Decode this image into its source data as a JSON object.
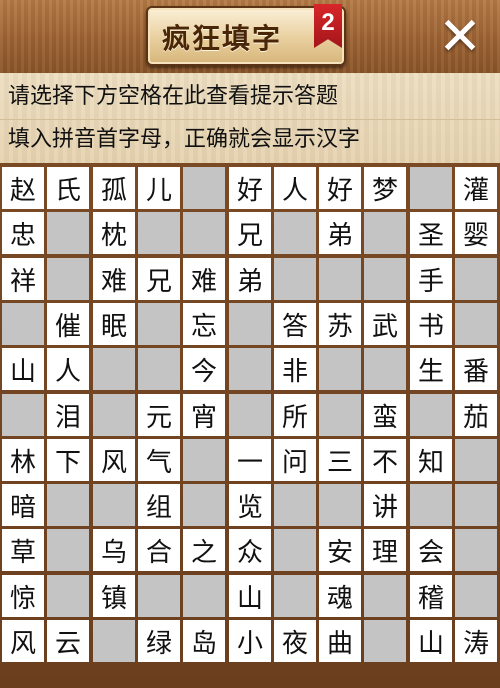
{
  "header": {
    "title": "疯狂填字",
    "level_badge": "2",
    "close_icon": "close-icon"
  },
  "hint": {
    "line1": "请选择下方空格在此查看提示答题",
    "line2": "填入拼音首字母，正确就会显示汉字"
  },
  "colors": {
    "header": "#9d6333",
    "hint_bg": "#e6d3b0",
    "grid_line": "#6b3f1e",
    "filled_cell": "#ffffff",
    "blank_cell": "#c4c4c4",
    "badge": "#c81e22"
  },
  "grid": {
    "rows": 11,
    "cols": 11,
    "cells": [
      [
        "赵",
        "氏",
        "孤",
        "儿",
        "",
        "好",
        "人",
        "好",
        "梦",
        "",
        "灌"
      ],
      [
        "忠",
        "",
        "枕",
        "",
        "",
        "兄",
        "",
        "弟",
        "",
        "圣",
        "婴"
      ],
      [
        "祥",
        "",
        "难",
        "兄",
        "难",
        "弟",
        "",
        "",
        "",
        "手",
        ""
      ],
      [
        "",
        "催",
        "眠",
        "",
        "忘",
        "",
        "答",
        "苏",
        "武",
        "书",
        ""
      ],
      [
        "山",
        "人",
        "",
        "",
        "今",
        "",
        "非",
        "",
        "",
        "生",
        "番"
      ],
      [
        "",
        "泪",
        "",
        "元",
        "宵",
        "",
        "所",
        "",
        "蛮",
        "",
        "茄"
      ],
      [
        "林",
        "下",
        "风",
        "气",
        "",
        "一",
        "问",
        "三",
        "不",
        "知",
        ""
      ],
      [
        "暗",
        "",
        "",
        "组",
        "",
        "览",
        "",
        "",
        "讲",
        "",
        ""
      ],
      [
        "草",
        "",
        "乌",
        "合",
        "之",
        "众",
        "",
        "安",
        "理",
        "会",
        ""
      ],
      [
        "惊",
        "",
        "镇",
        "",
        "",
        "山",
        "",
        "魂",
        "",
        "稽",
        ""
      ],
      [
        "风",
        "云",
        "",
        "绿",
        "岛",
        "小",
        "夜",
        "曲",
        "",
        "山",
        "涛"
      ]
    ]
  }
}
